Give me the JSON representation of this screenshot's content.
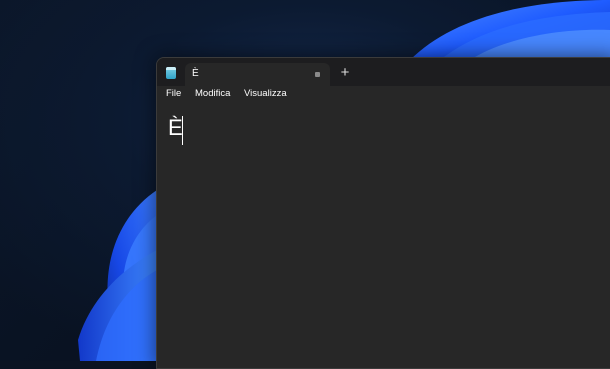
{
  "colors": {
    "window_bg": "#272727",
    "title_bar_bg": "#1d1d1f",
    "wallpaper_blue": "#1f5cff",
    "desktop_dark": "#0a1322"
  },
  "notepad": {
    "app_icon": "notepad-icon",
    "tab": {
      "title": "È",
      "close_icon": "tab-close-icon"
    },
    "new_tab_label": "+",
    "menu": [
      {
        "label": "File"
      },
      {
        "label": "Modifica"
      },
      {
        "label": "Visualizza"
      }
    ],
    "editor": {
      "content": "È"
    }
  }
}
